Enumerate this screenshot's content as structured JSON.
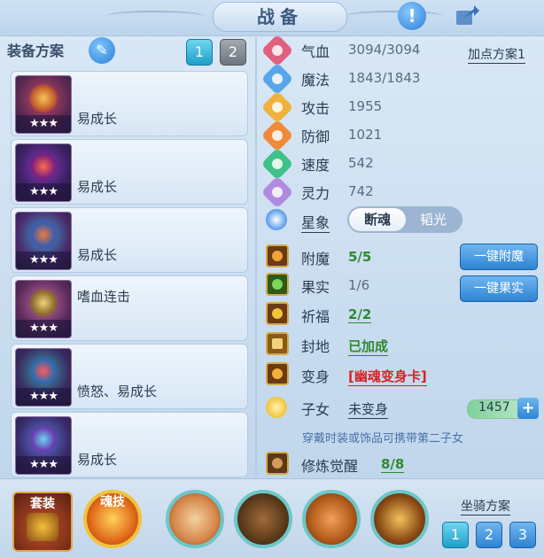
{
  "header": {
    "title": "战备",
    "info_icon": "exclamation-icon",
    "share_icon": "share-arrow-icon"
  },
  "equip_plan": {
    "label": "装备方案",
    "edit_icon": "pencil-icon",
    "plans": [
      "1",
      "2"
    ],
    "active_plan": "1"
  },
  "equipment": [
    {
      "stars": "★★★",
      "text": "易成长"
    },
    {
      "stars": "★★★",
      "text": "易成长"
    },
    {
      "stars": "★★★",
      "text": "易成长"
    },
    {
      "stars": "★★★",
      "text": "嗜血连击"
    },
    {
      "stars": "★★★",
      "text": "愤怒、易成长"
    },
    {
      "stars": "★★★",
      "text": "易成长"
    }
  ],
  "stats": {
    "attr_plan": "加点方案1",
    "rows": [
      {
        "name": "气血",
        "value": "3094/3094",
        "icon": "heart-icon",
        "color": "#e0607e"
      },
      {
        "name": "魔法",
        "value": "1843/1843",
        "icon": "mana-icon",
        "color": "#58a6ea"
      },
      {
        "name": "攻击",
        "value": "1955",
        "icon": "sword-icon",
        "color": "#f0b23a"
      },
      {
        "name": "防御",
        "value": "1021",
        "icon": "shield-icon",
        "color": "#f08a3a"
      },
      {
        "name": "速度",
        "value": "542",
        "icon": "speed-icon",
        "color": "#3ec289"
      },
      {
        "name": "灵力",
        "value": "742",
        "icon": "spirit-icon",
        "color": "#b28ae0"
      }
    ]
  },
  "constellation": {
    "label": "星象",
    "options": [
      "断魂",
      "韬光"
    ],
    "selected": "断魂"
  },
  "enhancements": {
    "enchant": {
      "name": "附魔",
      "value": "5/5",
      "button": "一键附魔"
    },
    "fruit": {
      "name": "果实",
      "value": "1/6",
      "button": "一键果实"
    },
    "blessing": {
      "name": "祈福",
      "value": "2/2"
    },
    "seal": {
      "name": "封地",
      "value": "已加成"
    },
    "transform": {
      "name": "变身",
      "value": "[幽魂变身卡]"
    },
    "child": {
      "name": "子女",
      "value": "未变身",
      "amount": "1457",
      "hint": "穿戴时装或饰品可携带第二子女"
    },
    "cultivation": {
      "name": "修炼觉醒",
      "value": "8/8"
    }
  },
  "bottom": {
    "set_label": "套装",
    "soul_skill_label": "魂技",
    "mount_plan_label": "坐骑方案",
    "mount_plans": [
      "1",
      "2",
      "3"
    ],
    "active_mount": "1"
  }
}
